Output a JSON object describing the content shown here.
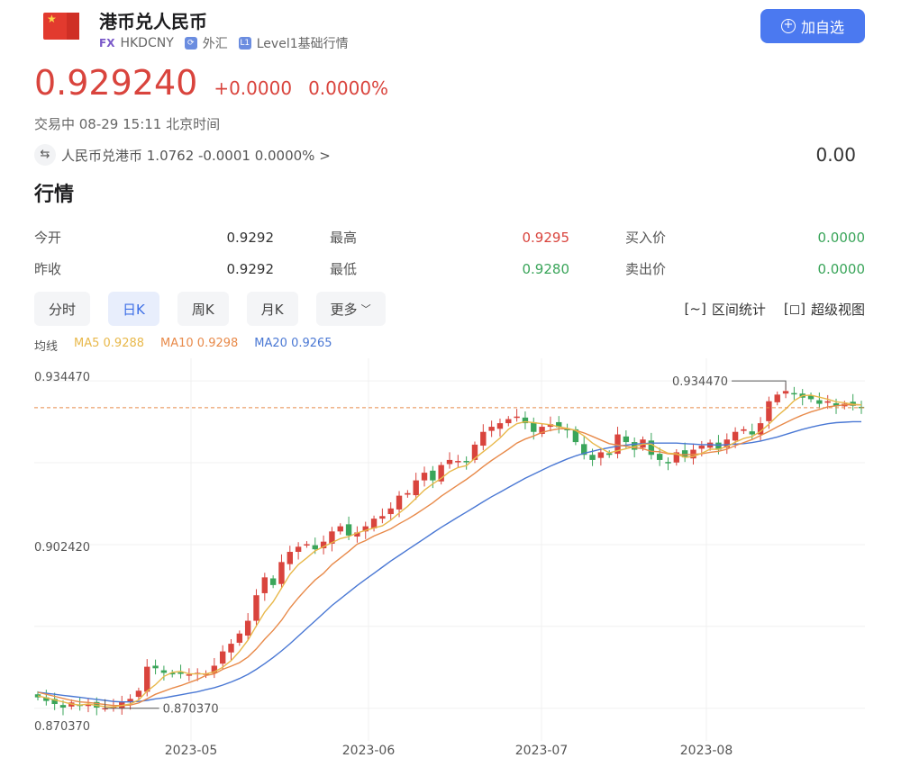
{
  "header": {
    "title": "港币兑人民币",
    "tag_fx": "FX",
    "symbol": "HKDCNY",
    "market": "外汇",
    "level": "Level1基础行情",
    "add_button": "加自选",
    "flag_icon": "hk-flag-icon"
  },
  "quote": {
    "price": "0.929240",
    "change": "+0.0000",
    "change_pct": "0.0000%",
    "status": "交易中 08-29 15:11 北京时间",
    "reverse_pair": "人民币兑港币 1.0762 -0.0001 0.0000% >",
    "reverse_value": "0.00"
  },
  "section": {
    "title": "行情"
  },
  "stats": {
    "open_label": "今开",
    "open": "0.9292",
    "high_label": "最高",
    "high": "0.9295",
    "bid_label": "买入价",
    "bid": "0.0000",
    "prev_close_label": "昨收",
    "prev_close": "0.9292",
    "low_label": "最低",
    "low": "0.9280",
    "ask_label": "卖出价",
    "ask": "0.0000"
  },
  "tabs": {
    "minute": "分时",
    "day": "日K",
    "week": "周K",
    "month": "月K",
    "more": "更多",
    "range_stats": "区间统计",
    "super_chart": "超级视图"
  },
  "ma": {
    "label": "均线",
    "ma5": "MA5 0.9288",
    "ma10": "MA10 0.9298",
    "ma20": "MA20 0.9265"
  },
  "colors": {
    "up": "#d9443d",
    "down": "#3aa55a",
    "ma5": "#e8b84a",
    "ma10": "#e88a4a",
    "ma20": "#4a78d4",
    "accent": "#4b79f0"
  },
  "chart_data": {
    "type": "candlestick",
    "y_top_label": "0.934470",
    "y_mid_label": "0.902420",
    "y_bottom_label": "0.870370",
    "max_annotation": "0.934470",
    "min_annotation": "0.870370",
    "ylim": [
      0.8675,
      0.9375
    ],
    "x_labels": [
      "2023-05",
      "2023-06",
      "2023-07",
      "2023-08"
    ],
    "current_price": 0.92924,
    "closes": [
      0.8725,
      0.8718,
      0.8712,
      0.8705,
      0.8715,
      0.8708,
      0.8712,
      0.8705,
      0.8704,
      0.8707,
      0.8716,
      0.8722,
      0.8738,
      0.8785,
      0.8782,
      0.8773,
      0.877,
      0.8771,
      0.877,
      0.8773,
      0.8772,
      0.8787,
      0.8815,
      0.883,
      0.885,
      0.8875,
      0.8925,
      0.896,
      0.8945,
      0.899,
      0.901,
      0.902,
      0.9025,
      0.9015,
      0.903,
      0.905,
      0.906,
      0.9042,
      0.9048,
      0.906,
      0.9075,
      0.908,
      0.9095,
      0.912,
      0.9125,
      0.915,
      0.9165,
      0.915,
      0.918,
      0.919,
      0.9188,
      0.9186,
      0.922,
      0.9245,
      0.9255,
      0.9262,
      0.927,
      0.9275,
      0.9262,
      0.9245,
      0.9255,
      0.926,
      0.9254,
      0.9248,
      0.9225,
      0.92,
      0.919,
      0.9205,
      0.92,
      0.924,
      0.9225,
      0.921,
      0.923,
      0.92,
      0.919,
      0.9185,
      0.9205,
      0.9195,
      0.921,
      0.9218,
      0.9224,
      0.921,
      0.923,
      0.9245,
      0.925,
      0.924,
      0.9262,
      0.9305,
      0.9318,
      0.9325,
      0.932,
      0.9312,
      0.9309,
      0.93,
      0.9305,
      0.9295,
      0.93,
      0.9296,
      0.9292
    ],
    "ma5": [
      0.8728,
      0.8724,
      0.872,
      0.8716,
      0.8712,
      0.871,
      0.8712,
      0.8709,
      0.8707,
      0.8706,
      0.8709,
      0.8712,
      0.872,
      0.8737,
      0.875,
      0.8766,
      0.8774,
      0.8776,
      0.8771,
      0.8771,
      0.8771,
      0.8775,
      0.8784,
      0.8797,
      0.8815,
      0.8837,
      0.8865,
      0.8892,
      0.8912,
      0.8939,
      0.8966,
      0.8985,
      0.8998,
      0.9012,
      0.902,
      0.9028,
      0.9036,
      0.904,
      0.9047,
      0.9052,
      0.9057,
      0.9061,
      0.9072,
      0.9086,
      0.9099,
      0.9115,
      0.9131,
      0.9143,
      0.9154,
      0.9167,
      0.9175,
      0.9179,
      0.9193,
      0.9206,
      0.9219,
      0.9233,
      0.925,
      0.9261,
      0.9265,
      0.9263,
      0.9261,
      0.9259,
      0.9255,
      0.9252,
      0.9248,
      0.9237,
      0.9223,
      0.9213,
      0.9204,
      0.9208,
      0.9212,
      0.9216,
      0.9221,
      0.9221,
      0.9211,
      0.9203,
      0.9202,
      0.9195,
      0.9197,
      0.9203,
      0.9211,
      0.9211,
      0.9216,
      0.9225,
      0.9232,
      0.9236,
      0.9246,
      0.926,
      0.9276,
      0.929,
      0.9306,
      0.9316,
      0.9317,
      0.9313,
      0.9309,
      0.9304,
      0.9302,
      0.9299,
      0.9298
    ],
    "ma10": [
      0.8735,
      0.8731,
      0.8727,
      0.8723,
      0.8719,
      0.8716,
      0.8715,
      0.8713,
      0.8711,
      0.8709,
      0.8709,
      0.871,
      0.8714,
      0.8722,
      0.8731,
      0.8737,
      0.8743,
      0.8748,
      0.8754,
      0.876,
      0.8768,
      0.8771,
      0.878,
      0.8786,
      0.8793,
      0.8804,
      0.882,
      0.8839,
      0.8856,
      0.8876,
      0.89,
      0.892,
      0.8938,
      0.8955,
      0.8968,
      0.8985,
      0.8998,
      0.9011,
      0.9025,
      0.9032,
      0.9041,
      0.9048,
      0.9055,
      0.9065,
      0.9074,
      0.9084,
      0.9095,
      0.9106,
      0.9119,
      0.913,
      0.9141,
      0.9152,
      0.9164,
      0.9177,
      0.9189,
      0.92,
      0.9211,
      0.9223,
      0.9231,
      0.9237,
      0.9244,
      0.9248,
      0.9251,
      0.9251,
      0.9248,
      0.9243,
      0.9236,
      0.9229,
      0.9222,
      0.9219,
      0.9217,
      0.9214,
      0.9212,
      0.9207,
      0.9206,
      0.9202,
      0.9201,
      0.92,
      0.9201,
      0.9202,
      0.9205,
      0.9207,
      0.9211,
      0.9218,
      0.9224,
      0.923,
      0.9238,
      0.9246,
      0.9255,
      0.9263,
      0.9271,
      0.9278,
      0.9284,
      0.9289,
      0.9294,
      0.9296,
      0.9298,
      0.9298,
      0.9298
    ],
    "ma20": [
      0.8735,
      0.8733,
      0.8731,
      0.8729,
      0.8727,
      0.8725,
      0.8723,
      0.8721,
      0.8719,
      0.8717,
      0.8716,
      0.8716,
      0.8717,
      0.8719,
      0.8722,
      0.8724,
      0.8727,
      0.873,
      0.8733,
      0.8736,
      0.874,
      0.8744,
      0.8749,
      0.8755,
      0.8762,
      0.877,
      0.878,
      0.8791,
      0.8803,
      0.8816,
      0.883,
      0.8845,
      0.886,
      0.8875,
      0.889,
      0.8905,
      0.8918,
      0.8931,
      0.8944,
      0.8956,
      0.8968,
      0.898,
      0.8992,
      0.9003,
      0.9014,
      0.9025,
      0.9036,
      0.9047,
      0.9058,
      0.9068,
      0.9078,
      0.9088,
      0.9098,
      0.9108,
      0.9118,
      0.9127,
      0.9136,
      0.9145,
      0.9154,
      0.9162,
      0.917,
      0.9178,
      0.9185,
      0.9192,
      0.9198,
      0.9203,
      0.9207,
      0.9211,
      0.9214,
      0.9217,
      0.9219,
      0.9221,
      0.9222,
      0.9223,
      0.9223,
      0.9223,
      0.9223,
      0.9222,
      0.9221,
      0.922,
      0.922,
      0.9219,
      0.922,
      0.9221,
      0.9222,
      0.9224,
      0.9227,
      0.9231,
      0.9235,
      0.924,
      0.9245,
      0.925,
      0.9254,
      0.9258,
      0.9261,
      0.9263,
      0.9264,
      0.9265,
      0.9265
    ]
  }
}
